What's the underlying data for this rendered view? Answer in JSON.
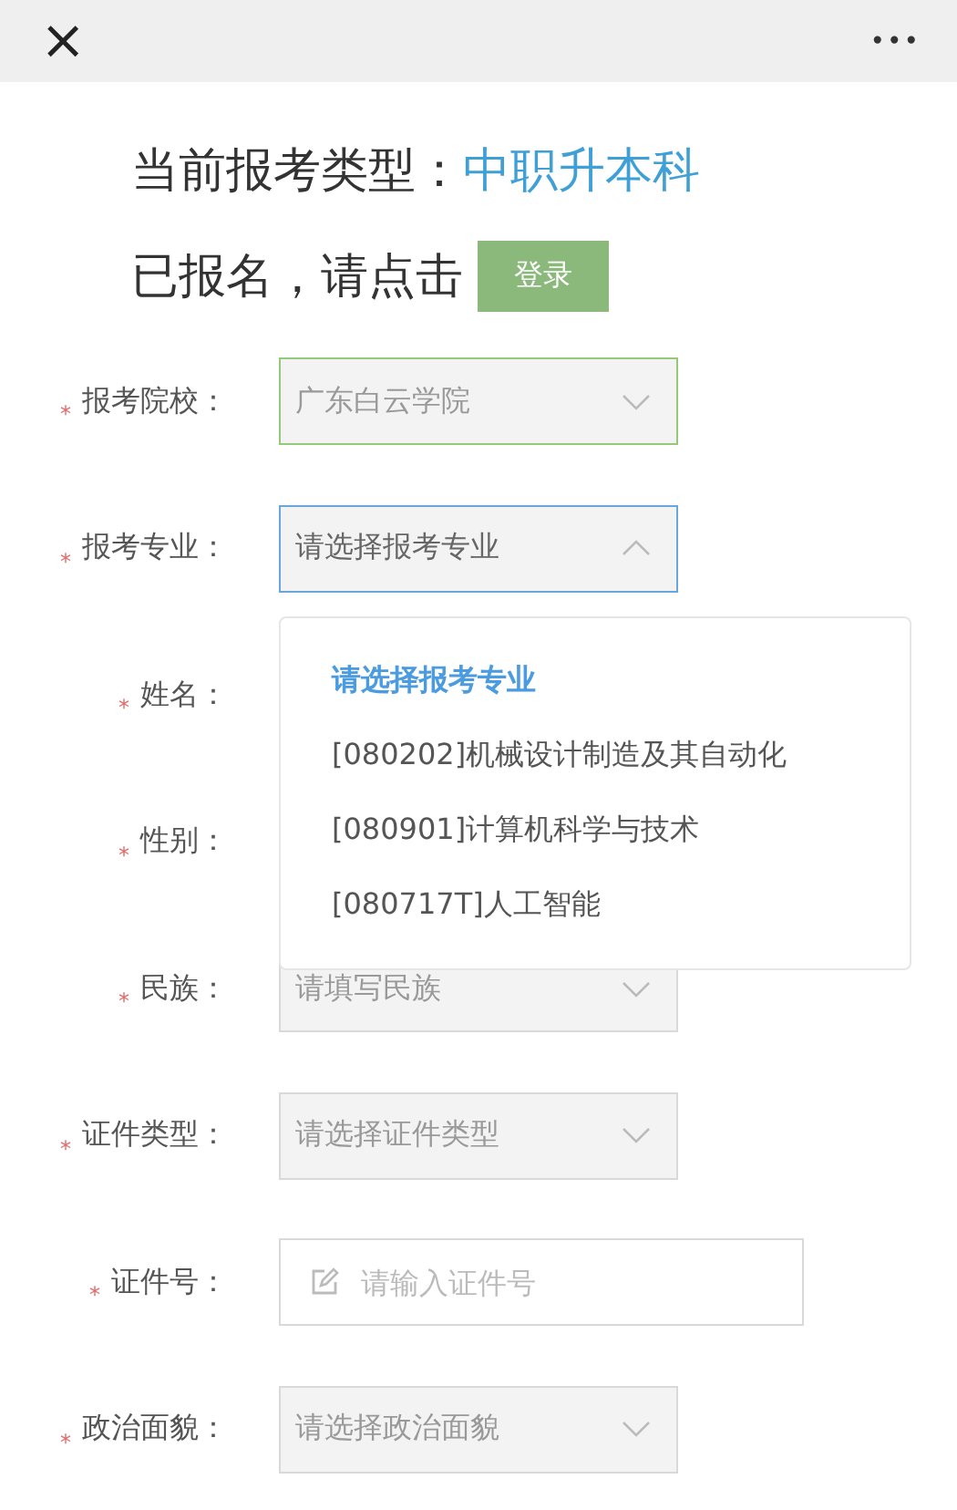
{
  "top_bar": {
    "close": "×",
    "more": "•••"
  },
  "heading": {
    "label": "当前报考类型：",
    "value": "中职升本科"
  },
  "login_prompt": {
    "text": "已报名，请点击",
    "button": "登录"
  },
  "rows": [
    {
      "required_mark": "*",
      "label": "报考院校：",
      "field": {
        "kind": "select",
        "value": "广东白云学院",
        "valid": true,
        "focused": false,
        "open": false
      }
    },
    {
      "required_mark": "*",
      "label": "报考专业：",
      "field": {
        "kind": "select",
        "value": "请选择报考专业",
        "valid": false,
        "focused": true,
        "open": true,
        "options": [
          {
            "label": "请选择报考专业",
            "selected": true
          },
          {
            "label": "[080202]机械设计制造及其自动化",
            "selected": false
          },
          {
            "label": "[080901]计算机科学与技术",
            "selected": false
          },
          {
            "label": "[080717T]人工智能",
            "selected": false
          }
        ]
      }
    },
    {
      "required_mark": "*",
      "label": "姓名："
    },
    {
      "required_mark": "*",
      "label": "性别："
    },
    {
      "required_mark": "*",
      "label": "民族：",
      "field": {
        "kind": "select",
        "placeholder": "请填写民族",
        "valid": false,
        "focused": false,
        "open": false
      }
    },
    {
      "required_mark": "*",
      "label": "证件类型：",
      "field": {
        "kind": "select",
        "placeholder": "请选择证件类型",
        "valid": false,
        "focused": false,
        "open": false
      }
    },
    {
      "required_mark": "*",
      "label": "证件号：",
      "field": {
        "kind": "input",
        "placeholder": "请输入证件号",
        "valid": false,
        "focused": false
      }
    },
    {
      "required_mark": "*",
      "label": "政治面貌：",
      "field": {
        "kind": "select",
        "placeholder": "请选择政治面貌",
        "valid": false,
        "focused": false,
        "open": false
      }
    }
  ]
}
